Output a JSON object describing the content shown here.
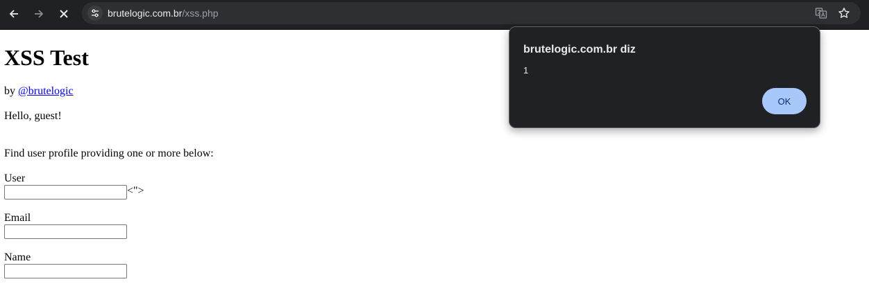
{
  "browser": {
    "url_host": "brutelogic.com.br",
    "url_path": "/xss.php",
    "icons": {
      "back": "back-arrow-icon",
      "forward": "forward-arrow-icon",
      "stop": "close-icon",
      "site_info": "tune-icon",
      "translate": "translate-icon",
      "bookmark": "star-icon"
    }
  },
  "page": {
    "title": "XSS Test",
    "byline_prefix": "by ",
    "author_link": "@brutelogic",
    "greeting": "Hello, guest!",
    "find_text": "Find user profile providing one or more below:",
    "fields": {
      "user": {
        "label": "User",
        "value": "",
        "injected_text": "<\">"
      },
      "email": {
        "label": "Email",
        "value": ""
      },
      "name": {
        "label": "Name",
        "value": ""
      }
    }
  },
  "dialog": {
    "title": "brutelogic.com.br diz",
    "message": "1",
    "ok_label": "OK"
  },
  "colors": {
    "toolbar_bg": "#202124",
    "omnibox_bg": "#2e2f33",
    "dialog_bg": "#202124",
    "ok_button_bg": "#a8c7fa",
    "link": "#0000ee"
  }
}
